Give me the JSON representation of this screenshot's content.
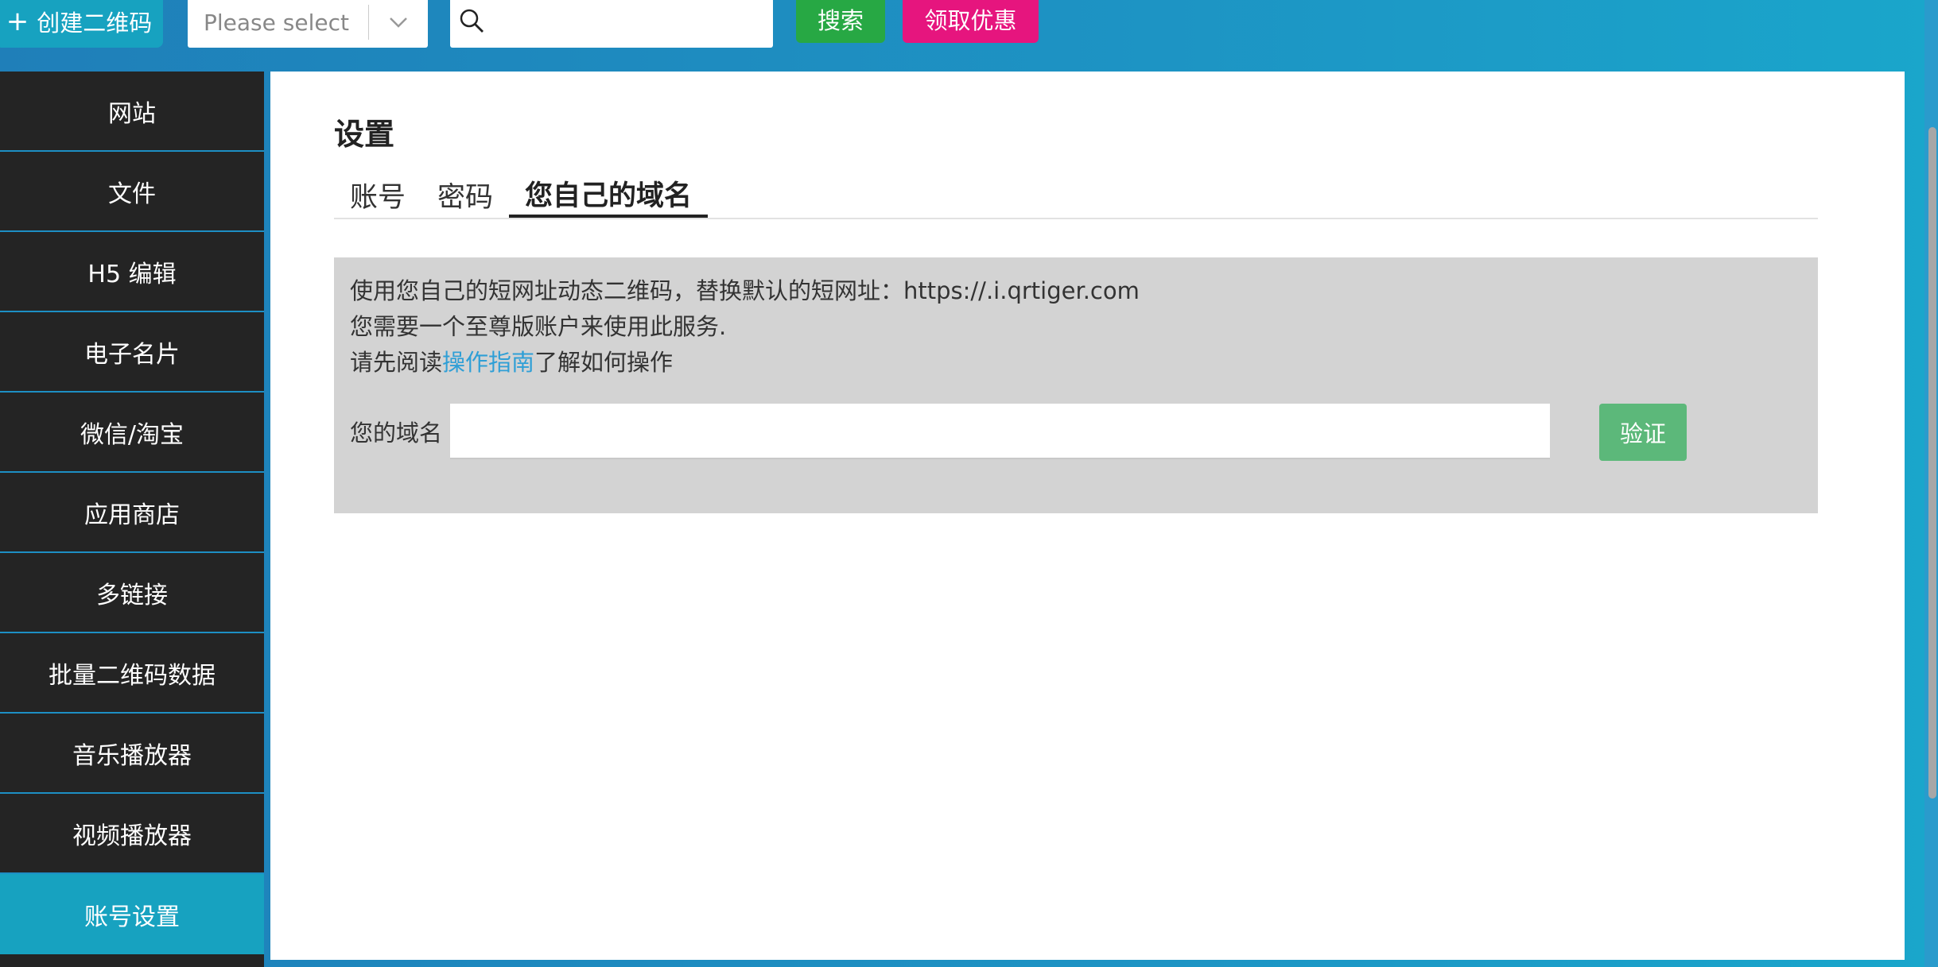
{
  "toolbar": {
    "create_label": "创建二维码",
    "create_icon": "+",
    "select_placeholder": "Please select",
    "search_placeholder": "",
    "search_label": "搜索",
    "promo_label": "领取优惠"
  },
  "sidebar": {
    "items": [
      {
        "label": "网站"
      },
      {
        "label": "文件"
      },
      {
        "label": "H5 编辑"
      },
      {
        "label": "电子名片"
      },
      {
        "label": "微信/淘宝"
      },
      {
        "label": "应用商店"
      },
      {
        "label": "多链接"
      },
      {
        "label": "批量二维码数据"
      },
      {
        "label": "音乐播放器"
      },
      {
        "label": "视频播放器"
      },
      {
        "label": "账号设置",
        "active": true
      }
    ]
  },
  "main": {
    "title": "设置",
    "tabs": [
      {
        "label": "账号"
      },
      {
        "label": "密码"
      },
      {
        "label": "您自己的域名",
        "active": true
      }
    ],
    "domain": {
      "line1": "使用您自己的短网址动态二维码，替换默认的短网址：https://.i.qrtiger.com",
      "line2": "您需要一个至尊版账户来使用此服务.",
      "line3_prefix": "请先阅读",
      "line3_link": "操作指南",
      "line3_suffix": "了解如何操作",
      "field_label": "您的域名",
      "field_value": "",
      "verify_label": "验证"
    }
  },
  "colors": {
    "accent": "#17a2c0",
    "search_green": "#27a844",
    "promo_pink": "#e6157e",
    "verify_green": "#5cb87a",
    "link_blue": "#2f9fd6",
    "sidebar_bg": "#242424"
  }
}
